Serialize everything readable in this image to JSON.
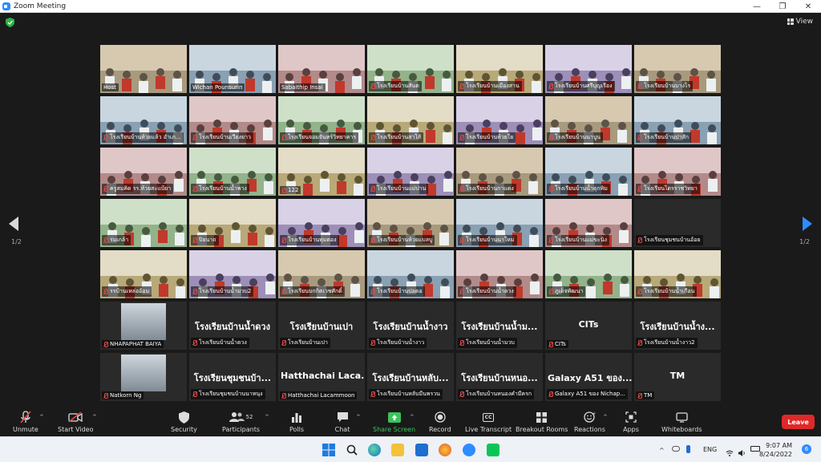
{
  "window": {
    "title": "Zoom Meeting",
    "minimize_glyph": "—",
    "maximize_glyph": "❐",
    "close_glyph": "✕"
  },
  "header": {
    "view_label": "View",
    "page_left": "1/2",
    "page_right": "1/2"
  },
  "tiles": [
    {
      "name": "Host",
      "type": "video",
      "active": true,
      "muted": false
    },
    {
      "name": "Wichan Pounsurin",
      "type": "video",
      "muted": false
    },
    {
      "name": "Sabaithip Insai",
      "type": "video",
      "muted": false
    },
    {
      "name": "โรงเรียนบ้านสันต",
      "type": "video",
      "muted": true
    },
    {
      "name": "โรงเรียนบ้านเมืองสาน",
      "type": "video",
      "muted": true
    },
    {
      "name": "โรงเรียนบ้านศรีบุญเรือง",
      "type": "video",
      "muted": true
    },
    {
      "name": "โรงเรียนบ้านบางไร",
      "type": "video",
      "muted": true
    },
    {
      "name": "โรงเรียนบ้านห้วยแล้ว อำเภ...",
      "type": "video",
      "muted": true
    },
    {
      "name": "โรงเรียนบ้านเวียงยาว",
      "type": "video",
      "muted": true
    },
    {
      "name": "โรงเรียนจอมจันทร์วิทยาคาร",
      "type": "video",
      "muted": true
    },
    {
      "name": "โรงเรียนบ้านสาไส้",
      "type": "video",
      "muted": true
    },
    {
      "name": "โรงเรียนบ้านห้วยใย",
      "type": "video",
      "muted": true
    },
    {
      "name": "โรงเรียนบ้านนาบูน",
      "type": "video",
      "muted": true
    },
    {
      "name": "โรงเรียนบ้านปาสัก",
      "type": "video",
      "muted": true
    },
    {
      "name": "ครูสมคิด รร.ห้วยสะแบ้ยา",
      "type": "video",
      "muted": true
    },
    {
      "name": "โรงเรียนบ้านน้ำพาง",
      "type": "video",
      "muted": true
    },
    {
      "name": "122",
      "type": "video",
      "muted": true
    },
    {
      "name": "โรงเรียนบ้านแม่ปาน",
      "type": "video",
      "muted": true
    },
    {
      "name": "โรงเรียนบ้านกาแดง",
      "type": "video",
      "muted": true
    },
    {
      "name": "โรงเรียนบ้านน้ำตุกทิม",
      "type": "video",
      "muted": true
    },
    {
      "name": "โรงเรียนไตรราชวิทยา",
      "type": "video",
      "muted": true
    },
    {
      "name": "ร่มเกล้า",
      "type": "video",
      "muted": true
    },
    {
      "name": "ปิยนาถ",
      "type": "video",
      "muted": true
    },
    {
      "name": "โรงเรียนบ้านทุ่มตอง",
      "type": "video",
      "muted": true
    },
    {
      "name": "โรงเรียนบ้านห้วยแบลบู",
      "type": "video",
      "muted": true
    },
    {
      "name": "โรงเรียนบ้านนาใหม่",
      "type": "video",
      "muted": true
    },
    {
      "name": "โรงเรียนบ้านแม่ขะนิง",
      "type": "video",
      "muted": true
    },
    {
      "name": "โรงเรียนชุมชนบ้านอ้อย",
      "type": "empty",
      "muted": true
    },
    {
      "name": "รรบ้านเหล่ออ้อม",
      "type": "video",
      "muted": true
    },
    {
      "name": "โรงเรียนบ้านน้ำมวบ2",
      "type": "video",
      "muted": true
    },
    {
      "name": "โรงเรียนบกกิตเวชศักดิ์",
      "type": "video",
      "muted": true
    },
    {
      "name": "โรงเรียนบ้านปอดอ",
      "type": "video",
      "muted": true
    },
    {
      "name": "โรงเรียนบ้านน้ำดวง",
      "type": "video",
      "muted": true
    },
    {
      "name": "ภูเด็จพัฒนา",
      "type": "video",
      "muted": true
    },
    {
      "name": "โรงเรียนบ้านน้ำเกือน",
      "type": "video",
      "muted": true
    },
    {
      "name": "NHAPAPHAT BAIYA",
      "type": "photo",
      "muted": true
    },
    {
      "name": "โรงเรียนบ้านน้ำดวง",
      "big": "โรงเรียนบ้านน้ำดวง",
      "type": "name",
      "muted": true
    },
    {
      "name": "โรงเรียนบ้านเปา",
      "big": "โรงเรียนบ้านเปา",
      "type": "name",
      "muted": true
    },
    {
      "name": "โรงเรียนบ้านน้ำงาว",
      "big": "โรงเรียนบ้านน้ำงาว",
      "type": "name",
      "muted": true
    },
    {
      "name": "โรงเรียนบ้านน้ำมวบ",
      "big": "โรงเรียนบ้านน้ำม...",
      "type": "name",
      "muted": true
    },
    {
      "name": "CITs",
      "big": "CITs",
      "type": "name",
      "muted": true
    },
    {
      "name": "โรงเรียนบ้านน้ำงาว2",
      "big": "โรงเรียนบ้านน้ำง...",
      "type": "name",
      "muted": true
    },
    {
      "name": "Natkorn Ng",
      "type": "photo",
      "muted": true
    },
    {
      "name": "โรงเรียนชุมชนบ้านนาหนุง",
      "big": "โรงเรียนชุมชนบ้า...",
      "type": "name",
      "muted": true
    },
    {
      "name": "Hatthachai Lacammoon",
      "big": "Hatthachai Laca...",
      "type": "name",
      "muted": true
    },
    {
      "name": "โรงเรียนบ้านหลับมืนพรวน",
      "big": "โรงเรียนบ้านหลับ...",
      "type": "name",
      "muted": true
    },
    {
      "name": "โรงเรียนบ้านหนองคำมีครก",
      "big": "โรงเรียนบ้านหนอ...",
      "type": "name",
      "muted": true
    },
    {
      "name": "Galaxy A51 ของ Nichap...",
      "big": "Galaxy A51 ของ...",
      "type": "name",
      "muted": true
    },
    {
      "name": "TM",
      "big": "TM",
      "type": "name",
      "muted": true
    }
  ],
  "toolbar": {
    "unmute": "Unmute",
    "start_video": "Start Video",
    "security": "Security",
    "participants": "Participants",
    "participant_count": "52",
    "polls": "Polls",
    "chat": "Chat",
    "share_screen": "Share Screen",
    "record": "Record",
    "live_transcript": "Live Transcript",
    "cc_glyph": "CC",
    "breakout_rooms": "Breakout Rooms",
    "reactions": "Reactions",
    "apps": "Apps",
    "whiteboards": "Whiteboards",
    "leave": "Leave"
  },
  "taskbar": {
    "lang": "ENG",
    "time": "9:07 AM",
    "date": "8/24/2022",
    "notifications": "6"
  },
  "colors": {
    "accent": "#2d8cff",
    "leave": "#e02828",
    "share": "#3ac45a",
    "muted": "#e54848",
    "active_speaker": "#c8e26a"
  }
}
